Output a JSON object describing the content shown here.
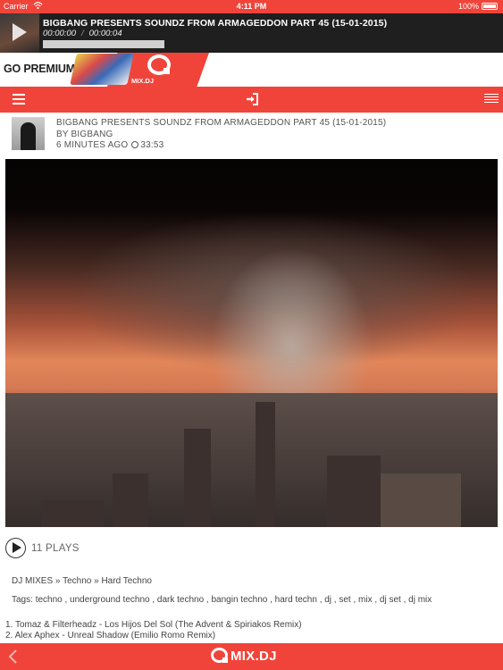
{
  "status_bar": {
    "carrier": "Carrier",
    "time": "4:11 PM",
    "battery": "100%",
    "wifi_icon": "wifi-icon",
    "battery_icon": "battery-icon"
  },
  "player": {
    "title": "BIGBANG PRESENTS SOUNDZ FROM ARMAGEDDON PART 45 (15-01-2015)",
    "elapsed": "00:00:00",
    "separator": "/",
    "duration": "00:00:04",
    "progress": 0.0,
    "play_icon": "play-icon"
  },
  "banner": {
    "go_premium": "GO PREMIUM",
    "logo_text": "MIX.DJ"
  },
  "navbar": {
    "menu_icon": "hamburger-menu-icon",
    "login_icon": "login-icon",
    "list_icon": "list-icon"
  },
  "mix": {
    "title": "BIGBANG PRESENTS SOUNDZ FROM ARMAGEDDON PART 45 (15-01-2015)",
    "by_prefix": "BY ",
    "artist": "BIGBANG",
    "posted": "6 MINUTES AGO",
    "length": "33:53",
    "plays": "11 PLAYS"
  },
  "breadcrumb": {
    "items": [
      "DJ MIXES",
      "Techno",
      "Hard Techno"
    ],
    "separator": "»"
  },
  "tags": {
    "label": "Tags:",
    "list": "techno , underground techno , dark techno , bangin techno , hard techn , dj , set , mix , dj set , dj mix"
  },
  "tracklist": [
    "1. Tomaz & Filterheadz - Los Hijos Del Sol (The Advent & Spiriakos Remix)",
    "2. Alex Aphex - Unreal Shadow (Emilio Romo Remix)"
  ],
  "bottom_bar": {
    "logo_text": "MIX.DJ",
    "back_icon": "back-arrow-icon"
  },
  "colors": {
    "accent": "#f0443a",
    "player_bg": "#1f1f1f"
  }
}
